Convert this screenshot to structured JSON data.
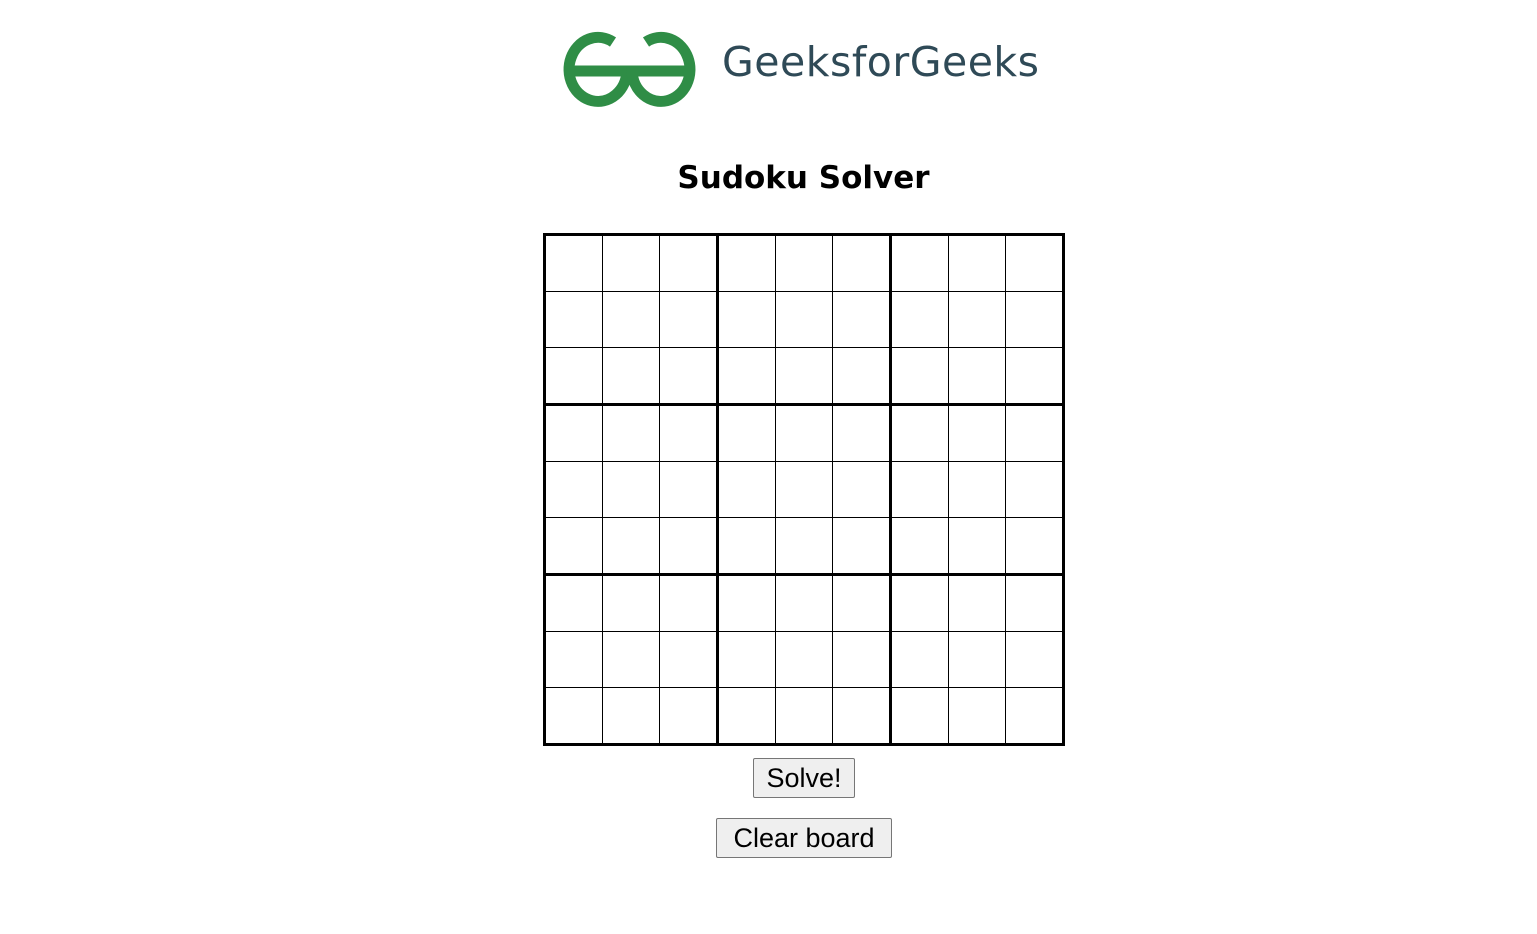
{
  "brand": {
    "name": "GeeksforGeeks",
    "logo_icon": "gfg-logo-icon",
    "logo_color": "#2f8d46",
    "text_color": "#2f4a57"
  },
  "page": {
    "title": "Sudoku Solver"
  },
  "board": {
    "rows": [
      [
        "",
        "",
        "",
        "",
        "",
        "",
        "",
        "",
        ""
      ],
      [
        "",
        "",
        "",
        "",
        "",
        "",
        "",
        "",
        ""
      ],
      [
        "",
        "",
        "",
        "",
        "",
        "",
        "",
        "",
        ""
      ],
      [
        "",
        "",
        "",
        "",
        "",
        "",
        "",
        "",
        ""
      ],
      [
        "",
        "",
        "",
        "",
        "",
        "",
        "",
        "",
        ""
      ],
      [
        "",
        "",
        "",
        "",
        "",
        "",
        "",
        "",
        ""
      ],
      [
        "",
        "",
        "",
        "",
        "",
        "",
        "",
        "",
        ""
      ],
      [
        "",
        "",
        "",
        "",
        "",
        "",
        "",
        "",
        ""
      ],
      [
        "",
        "",
        "",
        "",
        "",
        "",
        "",
        "",
        ""
      ]
    ]
  },
  "actions": {
    "solve_label": "Solve!",
    "clear_label": "Clear board"
  }
}
